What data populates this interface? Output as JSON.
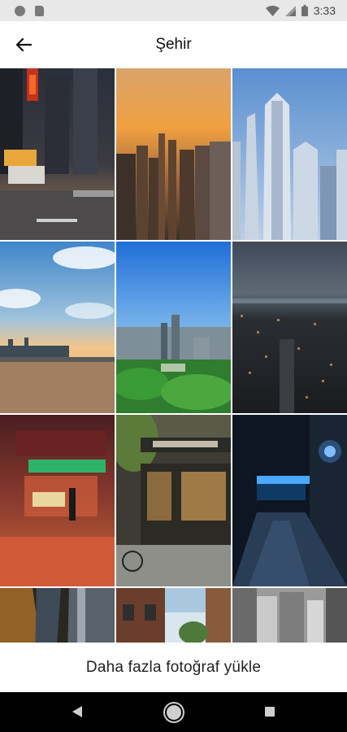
{
  "status_bar": {
    "time": "3:33",
    "icons": [
      "notification-dot-icon",
      "sd-card-icon",
      "wifi-icon",
      "cell-signal-icon",
      "battery-icon"
    ]
  },
  "app_bar": {
    "back_icon": "arrow-left-icon",
    "title": "Şehir"
  },
  "photo_grid": {
    "tiles": [
      {
        "subject": "neon-street-night"
      },
      {
        "subject": "skyline-sunset"
      },
      {
        "subject": "skyscrapers-blue-sky"
      },
      {
        "subject": "waterfront-skyline-sunset"
      },
      {
        "subject": "city-aerial-green-park"
      },
      {
        "subject": "aerial-city-night"
      },
      {
        "subject": "neon-shop-rain"
      },
      {
        "subject": "bread-ahead-bakery-storefront"
      },
      {
        "subject": "blue-lit-tunnel-night"
      },
      {
        "subject": "motion-blur-lights"
      },
      {
        "subject": "narrow-street-buildings"
      },
      {
        "subject": "monochrome-rooftops"
      }
    ]
  },
  "footer": {
    "load_more_label": "Daha fazla fotoğraf yükle"
  },
  "nav_bar": {
    "icons": [
      "nav-back-icon",
      "nav-home-icon",
      "nav-recents-icon"
    ]
  },
  "colors": {
    "status_bar_bg": "#e8e8e8",
    "app_bar_bg": "#ffffff",
    "nav_bar_bg": "#000000"
  }
}
